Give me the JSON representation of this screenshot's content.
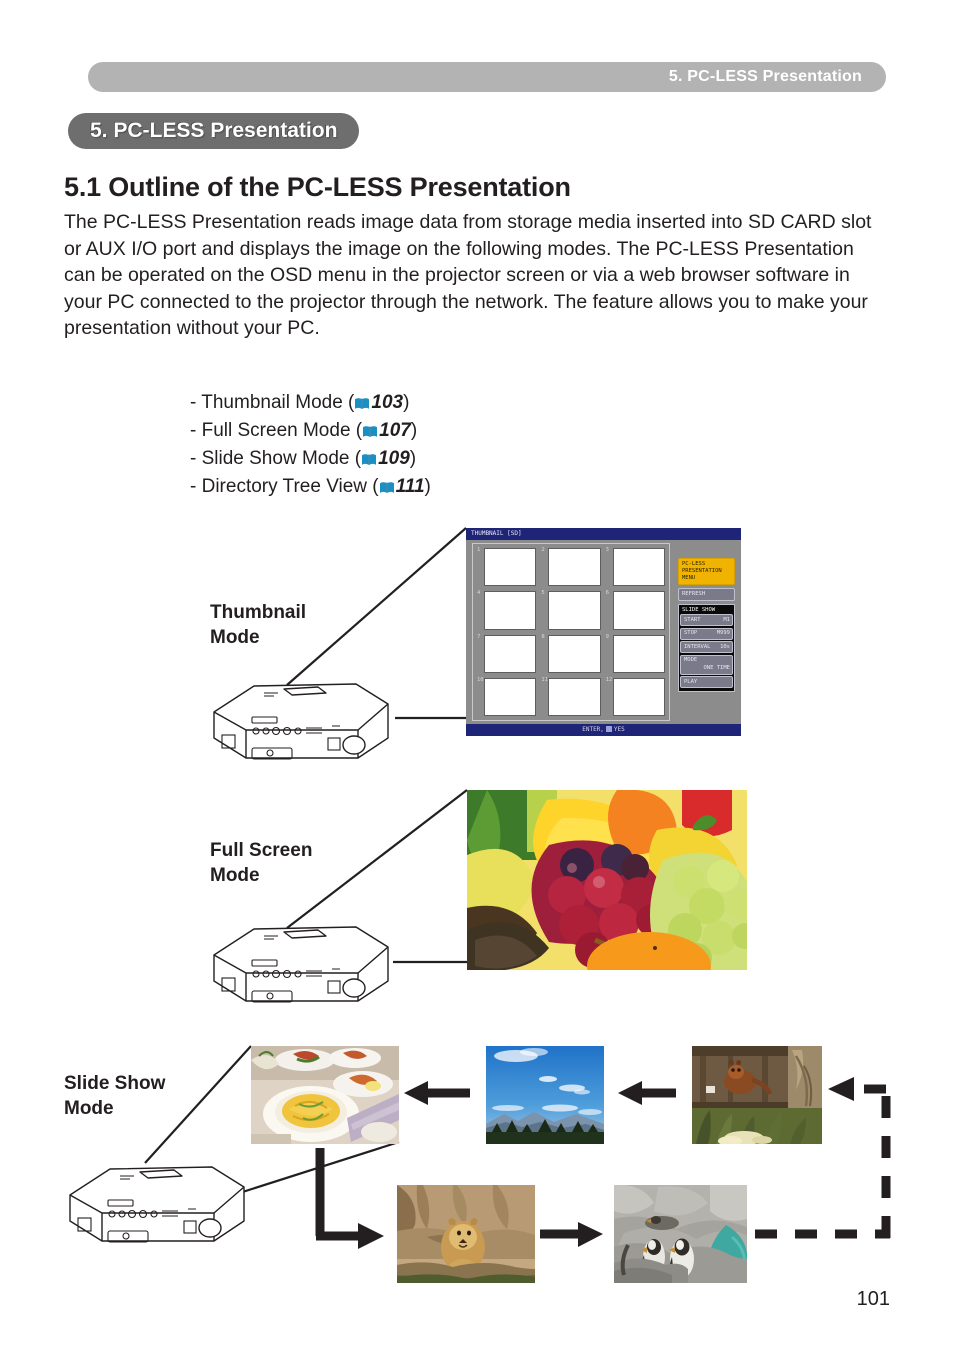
{
  "running_header": {
    "text": "5. PC-LESS Presentation"
  },
  "chapter_badge": {
    "text": "5. PC-LESS Presentation"
  },
  "section": {
    "heading": "5.1 Outline of the PC-LESS Presentation",
    "body": "The PC-LESS Presentation reads image data from storage media inserted into SD CARD slot or AUX I/O port and displays the image on the following modes. The PC-LESS Presentation can be operated on the OSD menu in the projector screen or via a web browser software in your PC connected to the projector through the network.\nThe feature allows you to make your presentation without your PC."
  },
  "mode_list": [
    {
      "prefix": "- Thumbnail Mode (",
      "page": "103",
      "suffix": ")"
    },
    {
      "prefix": "- Full Screen Mode (",
      "page": "107",
      "suffix": ")"
    },
    {
      "prefix": "- Slide Show Mode (",
      "page": "109",
      "suffix": ")"
    },
    {
      "prefix": "- Directory Tree View (",
      "page": "111",
      "suffix": ")"
    }
  ],
  "diagram_labels": {
    "thumbnail": "Thumbnail\nMode",
    "fullscreen": "Full Screen\nMode",
    "slideshow": "Slide Show\nMode"
  },
  "osd": {
    "titlebar": "THUMBNAIL [SD]",
    "footer_prefix": "ENTER,",
    "footer_suffix": "YES",
    "cell_numbers": [
      "1",
      "2",
      "3",
      "4",
      "5",
      "6",
      "7",
      "8",
      "9",
      "10",
      "11",
      "12"
    ],
    "menu_button": "PC-LESS\nPRESENTATION\nMENU",
    "refresh_button": "REFRESH",
    "slideshow_title": "SLIDE SHOW",
    "slideshow_rows": [
      {
        "label": "START",
        "value": "M1",
        "stacked": false
      },
      {
        "label": "STOP",
        "value": "M999",
        "stacked": false
      },
      {
        "label": "INTERVAL",
        "value": "10s",
        "stacked": false
      },
      {
        "label": "MODE",
        "value": "ONE TIME",
        "stacked": true
      },
      {
        "label": "PLAY",
        "value": "",
        "stacked": false
      }
    ]
  },
  "photos": {
    "fullscreen_caption": "fruit-assortment-photo",
    "food_caption": "food-plates-photo",
    "sky_caption": "blue-sky-landscape-photo",
    "panda_caption": "red-panda-photo",
    "lion_caption": "lion-photo",
    "penguin_caption": "penguins-photo"
  },
  "page_number": "101",
  "colors": {
    "header_gray": "#b3b3b3",
    "badge_gray": "#6e6e6e",
    "book_icon_blue": "#1b8fc4",
    "osd_blue": "#1e2476",
    "osd_highlight": "#f0b400",
    "text": "#231f20"
  }
}
